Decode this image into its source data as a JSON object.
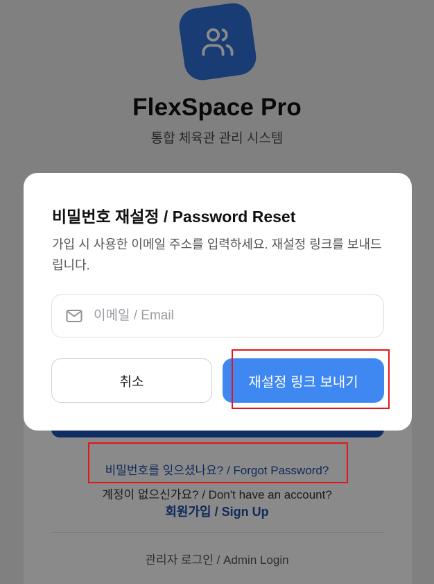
{
  "app": {
    "title": "FlexSpace Pro",
    "subtitle": "통합 체육관 관리 시스템"
  },
  "background": {
    "forgot_password": "비밀번호를 잊으셨나요? / Forgot Password?",
    "signup_prompt": "계정이 없으신가요? / Don't have an account?",
    "signup_link": "회원가입 / Sign Up",
    "admin_login": "관리자 로그인 / Admin Login"
  },
  "modal": {
    "title": "비밀번호 재설정 / Password Reset",
    "description": "가입 시 사용한 이메일 주소를 입력하세요. 재설정 링크를 보내드립니다.",
    "email": {
      "icon": "mail-icon",
      "placeholder": "이메일 / Email",
      "value": ""
    },
    "cancel_label": "취소",
    "send_label": "재설정 링크 보내기"
  },
  "colors": {
    "brand": "#2f6fd8",
    "primary_button": "#3f88f2",
    "link": "#1f4fa8",
    "highlight": "#e3161c"
  }
}
